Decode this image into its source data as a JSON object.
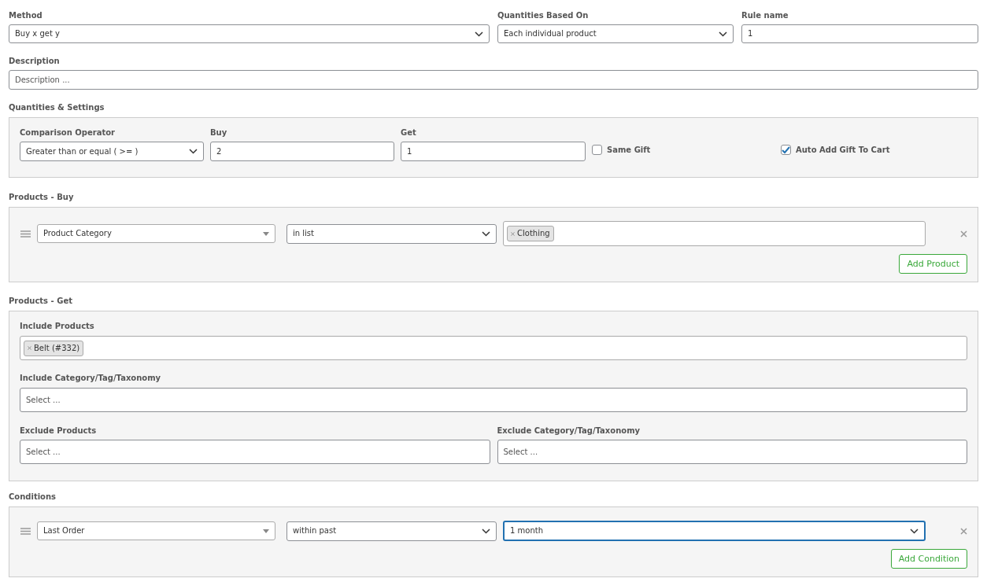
{
  "top_fields": [
    {
      "kind": "select",
      "label": "Method",
      "value": "Buy x get y"
    },
    {
      "kind": "select",
      "label": "Quantities Based On",
      "value": "Each individual product"
    },
    {
      "kind": "text",
      "label": "Rule name",
      "value": "1"
    }
  ],
  "description": {
    "label": "Description",
    "placeholder": "Description ..."
  },
  "quantities_settings": {
    "title": "Quantities & Settings",
    "fields": [
      {
        "kind": "select",
        "label": "Comparison Operator",
        "value": "Greater than or equal ( >= )"
      },
      {
        "kind": "text",
        "label": "Buy",
        "value": "2"
      },
      {
        "kind": "text",
        "label": "Get",
        "value": "1"
      }
    ],
    "checkboxes": [
      {
        "label": "Same Gift",
        "checked": false
      },
      {
        "label": "Auto Add Gift To Cart",
        "checked": true
      }
    ]
  },
  "products_buy": {
    "title": "Products - Buy",
    "rows": [
      {
        "field": "Product Category",
        "operator": "in list",
        "tags": [
          "Clothing"
        ]
      }
    ],
    "button": "Add Product"
  },
  "products_get": {
    "title": "Products - Get",
    "include_products": {
      "label": "Include Products",
      "tags": [
        "Belt (#332)"
      ]
    },
    "include_category": {
      "label": "Include Category/Tag/Taxonomy",
      "placeholder": "Select ..."
    },
    "exclude": [
      {
        "label": "Exclude Products",
        "placeholder": "Select ..."
      },
      {
        "label": "Exclude Category/Tag/Taxonomy",
        "placeholder": "Select ..."
      }
    ]
  },
  "conditions": {
    "title": "Conditions",
    "rows": [
      {
        "field": "Last Order",
        "operator": "within past",
        "value": "1 month",
        "focused": true
      }
    ],
    "button": "Add Condition"
  }
}
